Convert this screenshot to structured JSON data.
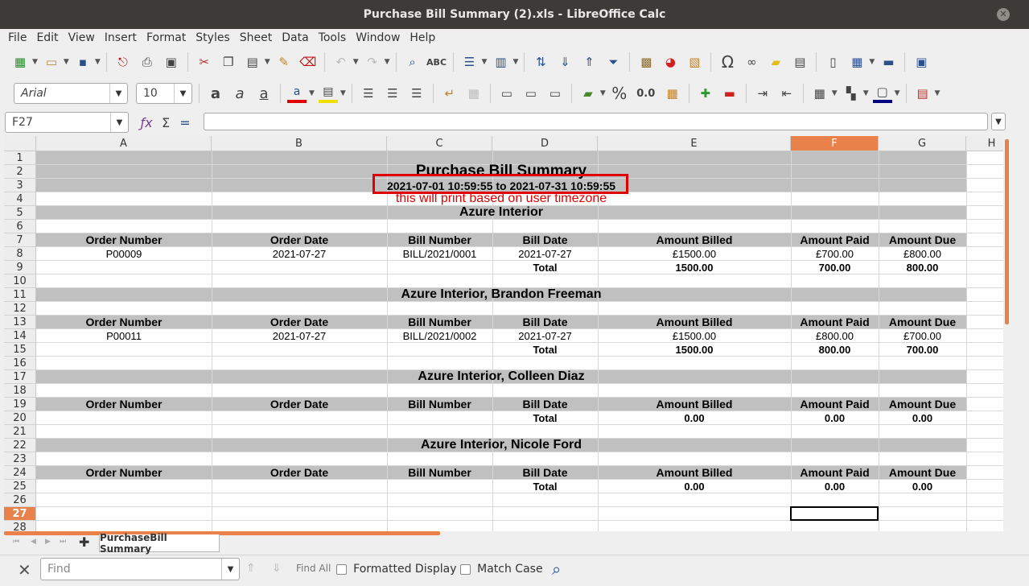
{
  "window": {
    "title": "Purchase Bill Summary (2).xls - LibreOffice Calc"
  },
  "menu": [
    "File",
    "Edit",
    "View",
    "Insert",
    "Format",
    "Styles",
    "Sheet",
    "Data",
    "Tools",
    "Window",
    "Help"
  ],
  "toolbar": {
    "font_name": "Arial",
    "font_size": "10",
    "percent": "%",
    "decimal": "0.0",
    "omega": "Ω"
  },
  "formula": {
    "cell_ref": "F27",
    "content": ""
  },
  "columns": [
    "A",
    "B",
    "C",
    "D",
    "E",
    "F",
    "G",
    "H"
  ],
  "selected_column": "F",
  "rows": [
    "1",
    "2",
    "3",
    "4",
    "5",
    "6",
    "7",
    "8",
    "9",
    "10",
    "11",
    "12",
    "13",
    "14",
    "15",
    "16",
    "17",
    "18",
    "19",
    "20",
    "21",
    "22",
    "23",
    "24",
    "25",
    "26",
    "27",
    "28"
  ],
  "selected_row": "27",
  "sheet": {
    "title": "Purchase Bill Summary",
    "date_range": "2021-07-01 10:59:55 to 2021-07-31 10:59:55",
    "note": "this will print based on user timezone",
    "headers": [
      "Order Number",
      "Order Date",
      "Bill Number",
      "Bill Date",
      "Amount Billed",
      "Amount Paid",
      "Amount Due"
    ],
    "total_label": "Total",
    "sections": [
      {
        "name": "Azure Interior",
        "rows": [
          [
            "P00009",
            "2021-07-27",
            "BILL/2021/0001",
            "2021-07-27",
            "£1500.00",
            "£700.00",
            "£800.00"
          ]
        ],
        "totals": [
          "1500.00",
          "700.00",
          "800.00"
        ]
      },
      {
        "name": "Azure Interior, Brandon Freeman",
        "rows": [
          [
            "P00011",
            "2021-07-27",
            "BILL/2021/0002",
            "2021-07-27",
            "£1500.00",
            "£800.00",
            "£700.00"
          ]
        ],
        "totals": [
          "1500.00",
          "800.00",
          "700.00"
        ]
      },
      {
        "name": "Azure Interior, Colleen Diaz",
        "rows": [],
        "totals": [
          "0.00",
          "0.00",
          "0.00"
        ]
      },
      {
        "name": "Azure Interior, Nicole Ford",
        "rows": [],
        "totals": [
          "0.00",
          "0.00",
          "0.00"
        ]
      }
    ]
  },
  "sheet_tab": "PurchaseBill Summary",
  "find": {
    "placeholder": "Find",
    "find_all": "Find All",
    "formatted_display": "Formatted Display",
    "match_case": "Match Case"
  }
}
